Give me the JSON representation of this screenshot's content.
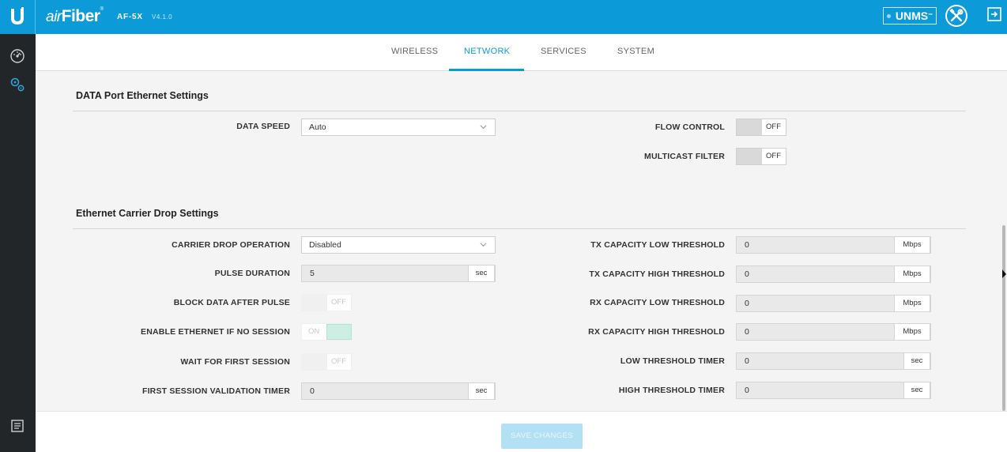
{
  "header": {
    "brand_prefix": "air",
    "brand_main": "Fiber",
    "brand_mark": "®",
    "model": "AF-5X",
    "version": "V4.1.0",
    "unms_label": "UNMS",
    "unms_mark": "™"
  },
  "tabs": [
    {
      "label": "WIRELESS",
      "active": false
    },
    {
      "label": "NETWORK",
      "active": true
    },
    {
      "label": "SERVICES",
      "active": false
    },
    {
      "label": "SYSTEM",
      "active": false
    }
  ],
  "data_port": {
    "title": "DATA Port Ethernet Settings",
    "data_speed_label": "DATA SPEED",
    "data_speed_value": "Auto",
    "flow_control_label": "FLOW CONTROL",
    "flow_control_state": "OFF",
    "multicast_filter_label": "MULTICAST FILTER",
    "multicast_filter_state": "OFF"
  },
  "carrier_drop": {
    "title": "Ethernet Carrier Drop Settings",
    "carrier_drop_operation_label": "CARRIER DROP OPERATION",
    "carrier_drop_operation_value": "Disabled",
    "pulse_duration_label": "PULSE DURATION",
    "pulse_duration_value": "5",
    "pulse_duration_unit": "sec",
    "block_data_label": "BLOCK DATA AFTER PULSE",
    "block_data_state": "OFF",
    "enable_ethernet_label": "ENABLE ETHERNET IF NO SESSION",
    "enable_ethernet_state": "ON",
    "wait_first_session_label": "WAIT FOR FIRST SESSION",
    "wait_first_session_state": "OFF",
    "first_session_timer_label": "FIRST SESSION VALIDATION TIMER",
    "first_session_timer_value": "0",
    "first_session_timer_unit": "sec",
    "tx_low_label": "TX CAPACITY LOW THRESHOLD",
    "tx_low_value": "0",
    "tx_low_unit": "Mbps",
    "tx_high_label": "TX CAPACITY HIGH THRESHOLD",
    "tx_high_value": "0",
    "tx_high_unit": "Mbps",
    "rx_low_label": "RX CAPACITY LOW THRESHOLD",
    "rx_low_value": "0",
    "rx_low_unit": "Mbps",
    "rx_high_label": "RX CAPACITY HIGH THRESHOLD",
    "rx_high_value": "0",
    "rx_high_unit": "Mbps",
    "low_timer_label": "LOW THRESHOLD TIMER",
    "low_timer_value": "0",
    "low_timer_unit": "sec",
    "high_timer_label": "HIGH THRESHOLD TIMER",
    "high_timer_value": "0",
    "high_timer_unit": "sec"
  },
  "footer": {
    "save_label": "SAVE CHANGES"
  },
  "icons": {
    "logo": "ubiquiti-logo-icon",
    "tools": "tools-icon",
    "logout": "logout-icon",
    "dashboard": "dashboard-icon",
    "settings": "settings-icon",
    "log": "log-icon"
  },
  "colors": {
    "accent": "#0c9bd8",
    "sidebar": "#222628"
  }
}
